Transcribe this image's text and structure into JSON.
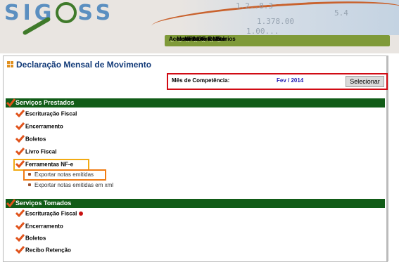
{
  "app": {
    "logo_text_left": "SIG",
    "logo_text_right": "SS"
  },
  "header": {
    "numbers": [
      "1.2..8.3",
      "5.4",
      "1.378.00",
      "1.00..."
    ]
  },
  "menu": [
    {
      "label": "Acessórios"
    },
    {
      "label": "Movimento"
    },
    {
      "label": "NFS-e"
    },
    {
      "label": "AIDF & NF"
    },
    {
      "label": "Vínculo"
    },
    {
      "label": "Relatórios"
    },
    {
      "label": "Sair"
    }
  ],
  "menu_separator": ":.",
  "page": {
    "title": "Declaração Mensal de Movimento",
    "period_label": "Mês de Competência:",
    "period_value": "Fev / 2014",
    "select_button": "Selecionar"
  },
  "services_provided": {
    "title": "Serviços Prestados",
    "items": [
      "Escrituração Fiscal",
      "Encerramento",
      "Boletos",
      "Livro Fiscal",
      "Ferramentas NF-e"
    ],
    "nfe_subitems": [
      "Exportar notas emitidas",
      "Exportar notas emitidas em xml"
    ]
  },
  "services_taken": {
    "title": "Serviços Tomados",
    "items": [
      "Escrituração Fiscal",
      "Encerramento",
      "Boletos",
      "Recibo Retenção"
    ]
  },
  "colors": {
    "section_bar": "#115c17",
    "menu_bar": "#7f9a39",
    "highlight_red": "#d10b14",
    "highlight_yellow": "#f2ab14",
    "highlight_orange": "#f07c14",
    "check": "#e0531b"
  },
  "icons": {
    "check": "check-icon",
    "bullet": "bullet-icon",
    "alert_dot": "red-dot-icon",
    "title": "orange-squares-icon"
  }
}
